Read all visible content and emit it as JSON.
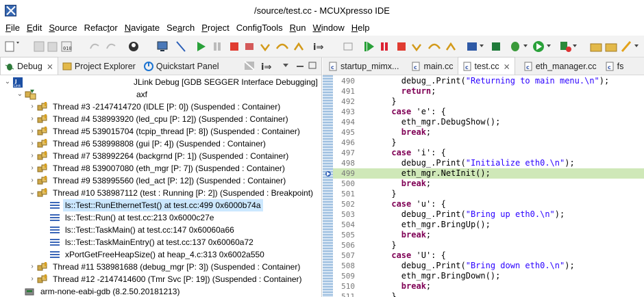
{
  "window": {
    "title": "/source/test.cc - MCUXpresso IDE"
  },
  "menu": [
    {
      "pre": "",
      "u": "F",
      "post": "ile"
    },
    {
      "pre": "",
      "u": "E",
      "post": "dit"
    },
    {
      "pre": "",
      "u": "S",
      "post": "ource"
    },
    {
      "pre": "Refac",
      "u": "t",
      "post": "or"
    },
    {
      "pre": "",
      "u": "N",
      "post": "avigate"
    },
    {
      "pre": "Se",
      "u": "a",
      "post": "rch"
    },
    {
      "pre": "",
      "u": "P",
      "post": "roject"
    },
    {
      "pre": "ConfigTools",
      "u": "",
      "post": ""
    },
    {
      "pre": "",
      "u": "R",
      "post": "un"
    },
    {
      "pre": "",
      "u": "W",
      "post": "indow"
    },
    {
      "pre": "",
      "u": "H",
      "post": "elp"
    }
  ],
  "left_tabs": {
    "debug": "Debug",
    "project_explorer": "Project Explorer",
    "quickstart": "Quickstart Panel"
  },
  "right_tabs": [
    "startup_mimx...",
    "main.cc",
    "test.cc",
    "eth_manager.cc",
    "fs"
  ],
  "tree": {
    "session": "JLink Debug [GDB SEGGER Interface Debugging]",
    "target": "axf",
    "threads_before": [
      "Thread #3 -2147414720 (IDLE [P: 0]) (Suspended : Container)",
      "Thread #4 538993920 (led_cpu [P: 12]) (Suspended : Container)",
      "Thread #5 539015704 (tcpip_thread [P: 8]) (Suspended : Container)",
      "Thread #6 538998808 (gui [P: 4]) (Suspended : Container)",
      "Thread #7 538992264 (backgrnd [P: 1]) (Suspended : Container)",
      "Thread #8 539007080 (eth_mgr [P: 7]) (Suspended : Container)",
      "Thread #9 538995560 (led_act [P: 12]) (Suspended : Container)"
    ],
    "current_thread": "Thread #10 538987112 (test : Running [P: 2]) (Suspended : Breakpoint)",
    "frames": [
      "ls::Test::RunEthernetTest() at test.cc:499 0x6000b74a",
      "ls::Test::Run() at test.cc:213 0x6000c27e",
      "ls::Test::TaskMain() at test.cc:147 0x60060a66",
      "ls::Test::TaskMainEntry() at test.cc:137 0x60060a72",
      "xPortGetFreeHeapSize() at heap_4.c:313 0x6002a550"
    ],
    "threads_after": [
      "Thread #11 538981688 (debug_mgr [P: 3]) (Suspended : Container)",
      "Thread #12 -2147414600 (Tmr Svc [P: 19]) (Suspended : Container)"
    ],
    "gdb": "arm-none-eabi-gdb (8.2.50.20181213)"
  },
  "code": {
    "current_line": "499",
    "lines": [
      {
        "n": "490",
        "parts": [
          [
            "",
            "        debug_.Print("
          ],
          [
            "str",
            "\"Returning to main menu.\\n\""
          ],
          [
            "",
            ");"
          ]
        ]
      },
      {
        "n": "491",
        "parts": [
          [
            "",
            "        "
          ],
          [
            "kw",
            "return"
          ],
          [
            "",
            ";"
          ]
        ]
      },
      {
        "n": "492",
        "parts": [
          [
            "",
            "      }"
          ]
        ]
      },
      {
        "n": "493",
        "parts": [
          [
            "",
            "      "
          ],
          [
            "kw",
            "case"
          ],
          [
            "",
            " 'e': {"
          ]
        ]
      },
      {
        "n": "494",
        "parts": [
          [
            "",
            "        eth_mgr.DebugShow();"
          ]
        ]
      },
      {
        "n": "495",
        "parts": [
          [
            "",
            "        "
          ],
          [
            "kw",
            "break"
          ],
          [
            "",
            ";"
          ]
        ]
      },
      {
        "n": "496",
        "parts": [
          [
            "",
            "      }"
          ]
        ]
      },
      {
        "n": "497",
        "parts": [
          [
            "",
            "      "
          ],
          [
            "kw",
            "case"
          ],
          [
            "",
            " 'i': {"
          ]
        ]
      },
      {
        "n": "498",
        "parts": [
          [
            "",
            "        debug_.Print("
          ],
          [
            "str",
            "\"Initialize eth0.\\n\""
          ],
          [
            "",
            ");"
          ]
        ]
      },
      {
        "n": "499",
        "parts": [
          [
            "",
            "        eth_mgr.NetInit();"
          ]
        ]
      },
      {
        "n": "500",
        "parts": [
          [
            "",
            "        "
          ],
          [
            "kw",
            "break"
          ],
          [
            "",
            ";"
          ]
        ]
      },
      {
        "n": "501",
        "parts": [
          [
            "",
            "      }"
          ]
        ]
      },
      {
        "n": "502",
        "parts": [
          [
            "",
            "      "
          ],
          [
            "kw",
            "case"
          ],
          [
            "",
            " 'u': {"
          ]
        ]
      },
      {
        "n": "503",
        "parts": [
          [
            "",
            "        debug_.Print("
          ],
          [
            "str",
            "\"Bring up eth0.\\n\""
          ],
          [
            "",
            ");"
          ]
        ]
      },
      {
        "n": "504",
        "parts": [
          [
            "",
            "        eth_mgr.BringUp();"
          ]
        ]
      },
      {
        "n": "505",
        "parts": [
          [
            "",
            "        "
          ],
          [
            "kw",
            "break"
          ],
          [
            "",
            ";"
          ]
        ]
      },
      {
        "n": "506",
        "parts": [
          [
            "",
            "      }"
          ]
        ]
      },
      {
        "n": "507",
        "parts": [
          [
            "",
            "      "
          ],
          [
            "kw",
            "case"
          ],
          [
            "",
            " 'U': {"
          ]
        ]
      },
      {
        "n": "508",
        "parts": [
          [
            "",
            "        debug_.Print("
          ],
          [
            "str",
            "\"Bring down eth0.\\n\""
          ],
          [
            "",
            ");"
          ]
        ]
      },
      {
        "n": "509",
        "parts": [
          [
            "",
            "        eth_mgr.BringDown();"
          ]
        ]
      },
      {
        "n": "510",
        "parts": [
          [
            "",
            "        "
          ],
          [
            "kw",
            "break"
          ],
          [
            "",
            ";"
          ]
        ]
      },
      {
        "n": "511",
        "parts": [
          [
            "",
            "      }"
          ]
        ]
      }
    ]
  },
  "colors": {
    "keyword": "#7f0055",
    "string": "#2a00ff",
    "current_line_highlight": "#cfe8b8",
    "selection": "#cce8ff"
  }
}
